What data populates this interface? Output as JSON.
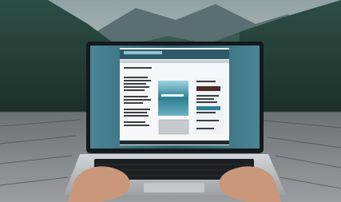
{
  "scene": {
    "subject": "laptop-on-wooden-desk",
    "setting": "forested-mountain-valley",
    "colors": {
      "sky": "#a8b7b5",
      "sky_glow": "#d7cbb7",
      "mountain_far": "#4f6468",
      "forest_dark": "#1f3a32",
      "forest_mid": "#2f5447",
      "desk_light": "#8b8f90",
      "desk_dark": "#3b3e40",
      "laptop_bezel": "#15191b",
      "laptop_body": "#b9bcbe",
      "screen_frame": "#3f6f7e",
      "document_bg": "#f6f7f8",
      "keyboard": "#1c1f21",
      "skin": "#c9987b"
    }
  },
  "screen": {
    "type": "document-viewer",
    "blocks": [
      "header-bar",
      "left-text-column",
      "center-image",
      "right-sidebar",
      "footer-toolbar"
    ]
  }
}
